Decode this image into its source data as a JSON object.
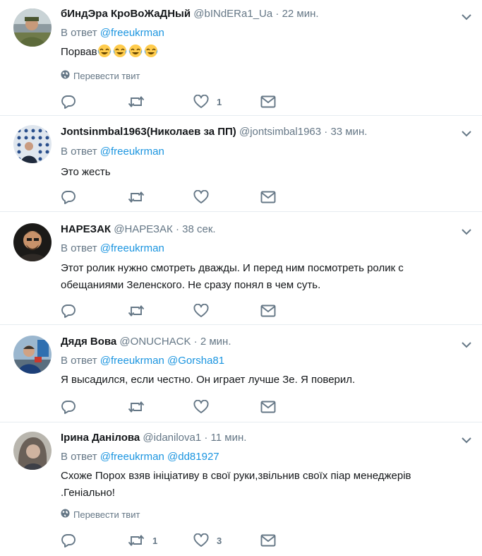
{
  "colors": {
    "link": "#1b95e0",
    "secondary": "#657786",
    "primary_text": "#14171a",
    "divider": "#e6ecf0"
  },
  "tweets": [
    {
      "fullname": "бИндЭра КроВоЖаДНый",
      "username": "@bINdERa1_Ua",
      "separator": "·",
      "time": "22 мин.",
      "reply_prefix": "В ответ",
      "mentions": [
        "@freeukrman"
      ],
      "text": "Порвав",
      "emoji": [
        "face-with-tears-of-joy",
        "face-with-tears-of-joy",
        "face-with-tears-of-joy",
        "face-with-tears-of-joy"
      ],
      "translate": "Перевести твит",
      "reply_count": "",
      "retweet_count": "",
      "like_count": "1"
    },
    {
      "fullname": "Jontsinmbal1963(Николаев за ПП)",
      "username": "@jontsimbal1963",
      "separator": "·",
      "time": "33 мин.",
      "reply_prefix": "В ответ",
      "mentions": [
        "@freeukrman"
      ],
      "text": "Это жесть",
      "reply_count": "",
      "retweet_count": "",
      "like_count": ""
    },
    {
      "fullname": "НАРЕЗАК",
      "username": "@НАРЕЗАК",
      "separator": "·",
      "time": "38 сек.",
      "reply_prefix": "В ответ",
      "mentions": [
        "@freeukrman"
      ],
      "text": "Этот ролик нужно смотреть дважды. И перед ним посмотреть ролик с обещаниями Зеленского. Не сразу понял в чем суть.",
      "reply_count": "",
      "retweet_count": "",
      "like_count": ""
    },
    {
      "fullname": "Дядя Вова",
      "username": "@ONUCHACK",
      "separator": "·",
      "time": "2 мин.",
      "reply_prefix": "В ответ",
      "mentions": [
        "@freeukrman",
        "@Gorsha81"
      ],
      "text": "Я высадился, если честно. Он играет лучше Зе. Я поверил.",
      "reply_count": "",
      "retweet_count": "",
      "like_count": ""
    },
    {
      "fullname": "Ірина Данілова",
      "username": "@idanilova1",
      "separator": "·",
      "time": "11 мин.",
      "reply_prefix": "В ответ",
      "mentions": [
        "@freeukrman",
        "@dd81927"
      ],
      "text": "Схоже  Порох взяв ініціативу в свої руки,звільнив своїх піар менеджерів .Геніально!",
      "translate": "Перевести твит",
      "reply_count": "",
      "retweet_count": "1",
      "like_count": "3"
    }
  ]
}
